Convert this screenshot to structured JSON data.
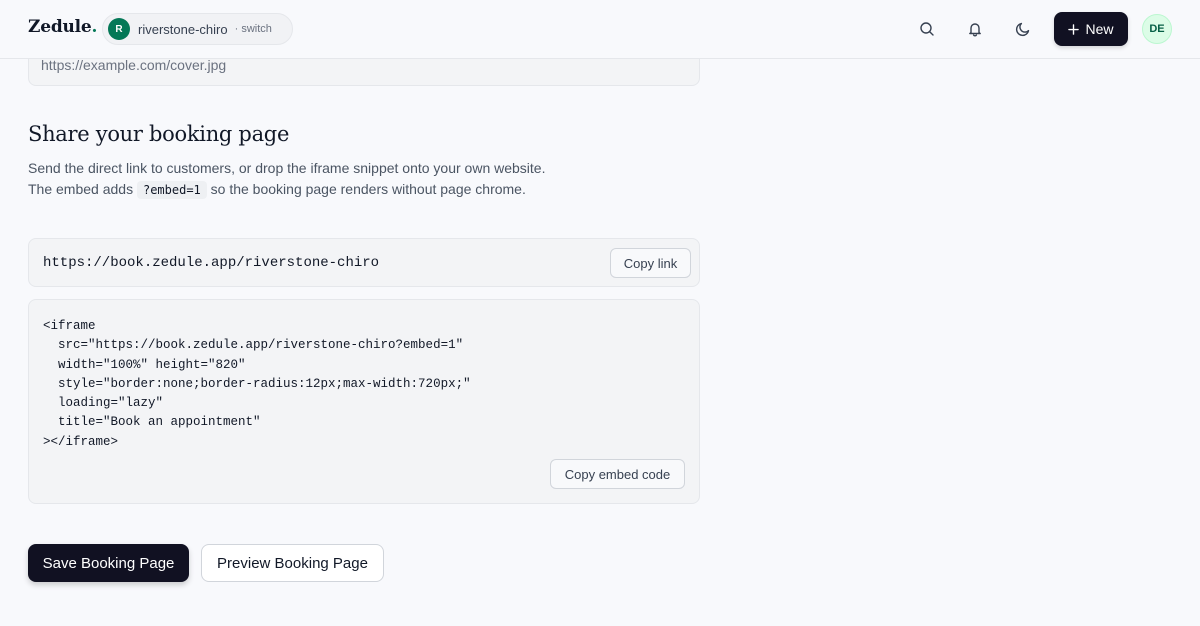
{
  "header": {
    "logo_text": "Zedule",
    "logo_dot": ".",
    "org": {
      "initial": "R",
      "name": "riverstone-chiro",
      "switch_label": "· switch"
    },
    "new_label": "New",
    "user_initials": "DE"
  },
  "form": {
    "cover_url_placeholder": "https://example.com/cover.jpg"
  },
  "share": {
    "title": "Share your booking page",
    "desc_before": "Send the direct link to customers, or drop the iframe snippet onto your own website. The embed adds ",
    "desc_code": "?embed=1",
    "desc_after": " so the booking page renders without page chrome.",
    "link": "https://book.zedule.app/riverstone-chiro",
    "copy_link_label": "Copy link",
    "embed_code": "<iframe\n  src=\"https://book.zedule.app/riverstone-chiro?embed=1\"\n  width=\"100%\" height=\"820\"\n  style=\"border:none;border-radius:12px;max-width:720px;\"\n  loading=\"lazy\"\n  title=\"Book an appointment\"\n></iframe>",
    "copy_embed_label": "Copy embed code"
  },
  "actions": {
    "save_label": "Save Booking Page",
    "preview_label": "Preview Booking Page"
  },
  "colors": {
    "brand_green": "#047857",
    "primary_dark": "#111122",
    "background": "#f8f9fc"
  }
}
